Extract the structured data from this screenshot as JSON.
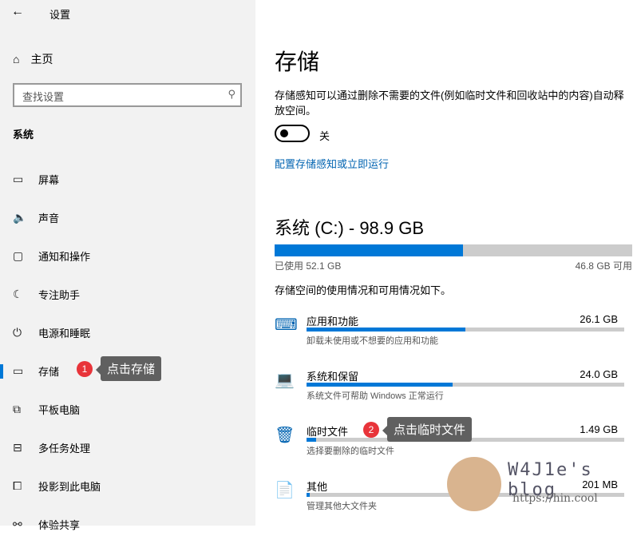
{
  "app": {
    "title": "设置",
    "back": "←"
  },
  "sidebar": {
    "home": "主页",
    "search_placeholder": "查找设置",
    "section": "系统",
    "items": [
      {
        "icon": "▭",
        "label": "屏幕"
      },
      {
        "icon": "🔈",
        "label": "声音"
      },
      {
        "icon": "▢",
        "label": "通知和操作"
      },
      {
        "icon": "☾",
        "label": "专注助手"
      },
      {
        "icon": "⏻",
        "label": "电源和睡眠"
      },
      {
        "icon": "▭",
        "label": "存储"
      },
      {
        "icon": "⧉",
        "label": "平板电脑"
      },
      {
        "icon": "⊟",
        "label": "多任务处理"
      },
      {
        "icon": "⧠",
        "label": "投影到此电脑"
      },
      {
        "icon": "⚯",
        "label": "体验共享"
      }
    ]
  },
  "annotations": {
    "step1": "1",
    "tip1": "点击存储",
    "step2": "2",
    "tip2": "点击临时文件"
  },
  "main": {
    "title": "存储",
    "desc": "存储感知可以通过删除不需要的文件(例如临时文件和回收站中的内容)自动释放空间。",
    "toggle_label": "关",
    "toggle_on": false,
    "link": "配置存储感知或立即运行",
    "drive": {
      "title": "系统 (C:) - 98.9 GB",
      "used": "已使用 52.1 GB",
      "free": "46.8 GB 可用",
      "used_fraction": 0.527
    },
    "usage_desc": "存储空间的使用情况和可用情况如下。",
    "categories": [
      {
        "icon": "⌨",
        "name": "应用和功能",
        "size": "26.1 GB",
        "desc": "卸载未使用或不想要的应用和功能",
        "fraction": 0.5
      },
      {
        "icon": "💻",
        "name": "系统和保留",
        "size": "24.0 GB",
        "desc": "系统文件可帮助 Windows 正常运行",
        "fraction": 0.46
      },
      {
        "icon": "🗑",
        "name": "临时文件",
        "size": "1.49 GB",
        "desc": "选择要删除的临时文件",
        "fraction": 0.03
      },
      {
        "icon": "📄",
        "name": "其他",
        "size": "201 MB",
        "desc": "管理其他大文件夹",
        "fraction": 0.01
      }
    ]
  },
  "watermark": {
    "line1": "W4J1e's blog",
    "line2": "https://hin.cool"
  }
}
